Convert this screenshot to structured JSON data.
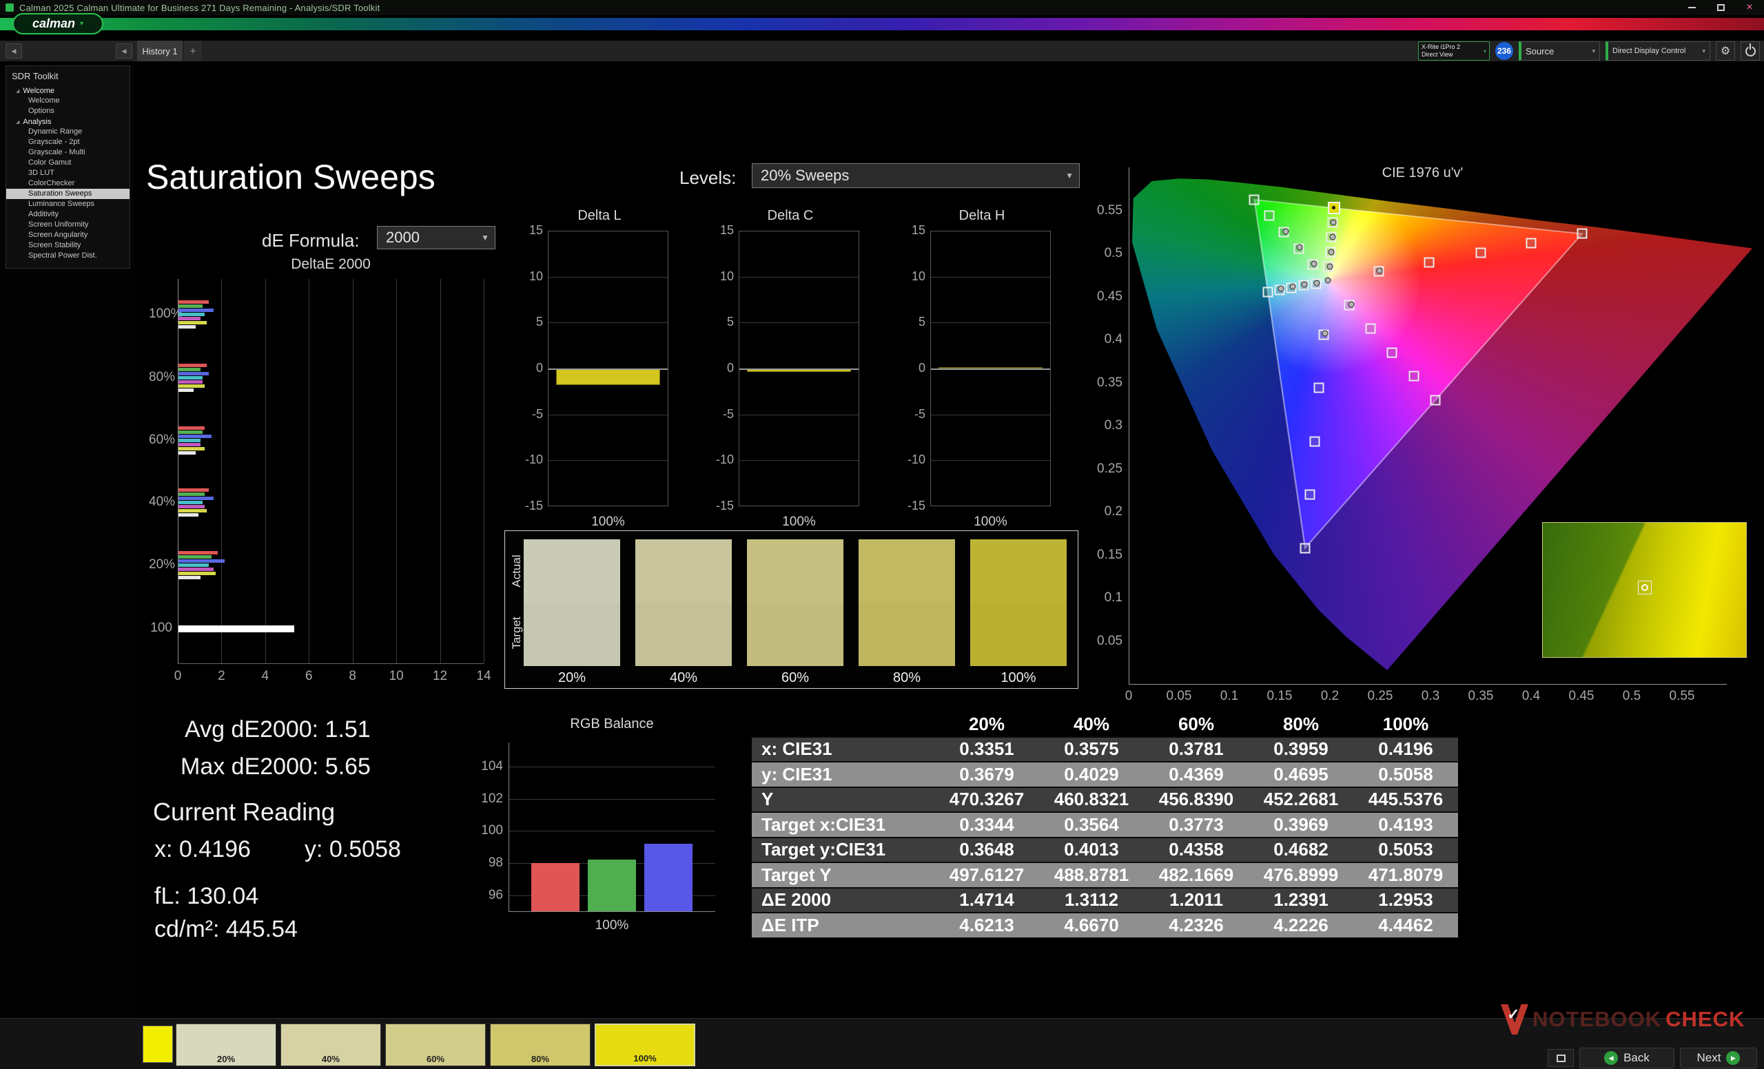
{
  "window": {
    "title": "Calman 2025 Calman Ultimate for Business 271 Days Remaining  - Analysis/SDR Toolkit"
  },
  "icons": {
    "close": "×",
    "dropdown": "▼",
    "small_caret": "▾",
    "tree_expanded": "◢",
    "back": "◀",
    "next": "▶",
    "collapse": "◀",
    "plus": "+",
    "gear": "⚙",
    "check": "✓"
  },
  "logo": {
    "text": "calman"
  },
  "toolbar": {
    "tab": "History 1",
    "meter_line1": "X-Rite i1Pro 2",
    "meter_line2": "Direct View",
    "badge": "236",
    "source": "Source",
    "display_control": "Direct Display Control"
  },
  "sidebar": {
    "header": "SDR Toolkit",
    "groups": [
      {
        "label": "Welcome",
        "items": [
          "Welcome",
          "Options"
        ]
      },
      {
        "label": "Analysis",
        "items": [
          "Dynamic Range",
          "Grayscale - 2pt",
          "Grayscale - Multi",
          "Color Gamut",
          "3D LUT",
          "ColorChecker",
          "Saturation Sweeps",
          "Luminance Sweeps",
          "Additivity",
          "Screen Uniformity",
          "Screen Angularity",
          "Screen Stability",
          "Spectral Power Dist."
        ]
      }
    ],
    "selected": "Saturation Sweeps"
  },
  "page": {
    "title": "Saturation Sweeps",
    "de_formula_label": "dE Formula:",
    "de_formula_value": "2000",
    "levels_label": "Levels:",
    "levels_value": "20% Sweeps"
  },
  "stats": {
    "avg": "Avg dE2000: 1.51",
    "max": "Max dE2000: 5.65",
    "current_heading": "Current Reading",
    "x": "x: 0.4196",
    "y": "y: 0.5058",
    "fl": "fL: 130.04",
    "cd": "cd/m²: 445.54"
  },
  "chart_data": [
    {
      "type": "bar",
      "title": "DeltaE 2000",
      "orientation": "horizontal",
      "xlim": [
        0,
        14
      ],
      "xticks": [
        0,
        2,
        4,
        6,
        8,
        10,
        12,
        14
      ],
      "bar_colors": [
        "#e05555",
        "#55b055",
        "#5868e0",
        "#48c0c8",
        "#c058c0",
        "#d8d848",
        "#e8e8e8"
      ],
      "clusters": [
        {
          "label": "100%",
          "values": [
            1.4,
            1.1,
            1.6,
            1.2,
            1.0,
            1.3,
            0.8
          ]
        },
        {
          "label": "80%",
          "values": [
            1.3,
            1.0,
            1.4,
            1.1,
            1.1,
            1.2,
            0.7
          ]
        },
        {
          "label": "60%",
          "values": [
            1.2,
            1.1,
            1.5,
            1.0,
            1.0,
            1.2,
            0.8
          ]
        },
        {
          "label": "40%",
          "values": [
            1.4,
            1.2,
            1.6,
            1.1,
            1.2,
            1.3,
            0.9
          ]
        },
        {
          "label": "20%",
          "values": [
            1.8,
            1.5,
            2.1,
            1.4,
            1.6,
            1.7,
            1.0
          ]
        },
        {
          "label": "100",
          "values": [
            5.3
          ],
          "colors": [
            "#ffffff"
          ]
        }
      ]
    },
    {
      "type": "bar",
      "title": "Delta L",
      "ylim": [
        -15,
        15
      ],
      "yticks": [
        15,
        10,
        5,
        0,
        -5,
        -10,
        -15
      ],
      "categories": [
        "100%"
      ],
      "values": [
        -1.8
      ],
      "color": "#d2c61f"
    },
    {
      "type": "bar",
      "title": "Delta C",
      "ylim": [
        -15,
        15
      ],
      "yticks": [
        15,
        10,
        5,
        0,
        -5,
        -10,
        -15
      ],
      "categories": [
        "100%"
      ],
      "values": [
        -0.4
      ],
      "color": "#d2c61f"
    },
    {
      "type": "bar",
      "title": "Delta H",
      "ylim": [
        -15,
        15
      ],
      "yticks": [
        15,
        10,
        5,
        0,
        -5,
        -10,
        -15
      ],
      "categories": [
        "100%"
      ],
      "values": [
        0.1
      ],
      "color": "#d2c61f"
    },
    {
      "type": "bar",
      "title": "RGB Balance",
      "ylim": [
        95,
        105.5
      ],
      "yticks": [
        104,
        102,
        100,
        98,
        96
      ],
      "categories": [
        "Red",
        "Green",
        "Blue"
      ],
      "values": [
        98.0,
        98.2,
        99.2
      ],
      "colors": [
        "#e05555",
        "#4fae4f",
        "#5858e8"
      ],
      "xlabel": "100%"
    },
    {
      "type": "scatter",
      "title": "CIE 1976 u'v'",
      "xlim": [
        0,
        0.62
      ],
      "ylim": [
        0,
        0.6
      ],
      "xticks": [
        "0",
        "0.05",
        "0.1",
        "0.15",
        "0.2",
        "0.25",
        "0.3",
        "0.35",
        "0.4",
        "0.45",
        "0.5",
        "0.55"
      ],
      "yticks": [
        "0.05",
        "0.1",
        "0.15",
        "0.2",
        "0.25",
        "0.3",
        "0.35",
        "0.4",
        "0.45",
        "0.5",
        "0.55"
      ],
      "white_point": [
        0.198,
        0.468
      ],
      "gamut_triangle": {
        "red": [
          0.4507,
          0.5229
        ],
        "green": [
          0.125,
          0.5625
        ],
        "blue": [
          0.1754,
          0.1579
        ]
      },
      "sweeps": [
        {
          "name": "red",
          "targets": [
            [
              0.249,
              0.479
            ],
            [
              0.299,
              0.49
            ],
            [
              0.35,
              0.501
            ],
            [
              0.4,
              0.512
            ],
            [
              0.4507,
              0.5229
            ]
          ]
        },
        {
          "name": "green",
          "targets": [
            [
              0.183,
              0.487
            ],
            [
              0.169,
              0.506
            ],
            [
              0.154,
              0.525
            ],
            [
              0.14,
              0.544
            ],
            [
              0.125,
              0.5625
            ]
          ]
        },
        {
          "name": "blue",
          "targets": [
            [
              0.194,
              0.406
            ],
            [
              0.189,
              0.344
            ],
            [
              0.185,
              0.282
            ],
            [
              0.18,
              0.22
            ],
            [
              0.1754,
              0.1579
            ]
          ]
        },
        {
          "name": "yellow",
          "targets": [
            [
              0.199,
              0.485
            ],
            [
              0.2005,
              0.502
            ],
            [
              0.2015,
              0.519
            ],
            [
              0.2027,
              0.536
            ],
            [
              0.2039,
              0.5529
            ]
          ]
        },
        {
          "name": "cyan",
          "targets": [
            [
              0.186,
              0.465
            ],
            [
              0.174,
              0.463
            ],
            [
              0.162,
              0.46
            ],
            [
              0.15,
              0.458
            ],
            [
              0.1383,
              0.4554
            ]
          ]
        },
        {
          "name": "magenta",
          "targets": [
            [
              0.219,
              0.44
            ],
            [
              0.2405,
              0.413
            ],
            [
              0.262,
              0.385
            ],
            [
              0.2835,
              0.358
            ],
            [
              0.305,
              0.3298
            ]
          ]
        }
      ],
      "measured": [
        [
          0.2,
          0.485
        ],
        [
          0.2015,
          0.502
        ],
        [
          0.2025,
          0.519
        ],
        [
          0.2035,
          0.536
        ],
        [
          0.184,
          0.488
        ],
        [
          0.17,
          0.507
        ],
        [
          0.156,
          0.526
        ],
        [
          0.187,
          0.466
        ],
        [
          0.175,
          0.464
        ],
        [
          0.163,
          0.4615
        ],
        [
          0.1515,
          0.459
        ],
        [
          0.2495,
          0.48
        ],
        [
          0.2215,
          0.441
        ],
        [
          0.1955,
          0.407
        ],
        [
          0.198,
          0.469
        ]
      ],
      "current_point": [
        0.2039,
        0.5529
      ],
      "inset": {
        "point": [
          0.5,
          0.48
        ]
      }
    }
  ],
  "table": {
    "columns": [
      "",
      "20%",
      "40%",
      "60%",
      "80%",
      "100%"
    ],
    "rows": [
      {
        "label": "x: CIE31",
        "values": [
          "0.3351",
          "0.3575",
          "0.3781",
          "0.3959",
          "0.4196"
        ]
      },
      {
        "label": "y: CIE31",
        "values": [
          "0.3679",
          "0.4029",
          "0.4369",
          "0.4695",
          "0.5058"
        ]
      },
      {
        "label": "Y",
        "values": [
          "470.3267",
          "460.8321",
          "456.8390",
          "452.2681",
          "445.5376"
        ]
      },
      {
        "label": "Target x:CIE31",
        "values": [
          "0.3344",
          "0.3564",
          "0.3773",
          "0.3969",
          "0.4193"
        ]
      },
      {
        "label": "Target y:CIE31",
        "values": [
          "0.3648",
          "0.4013",
          "0.4358",
          "0.4682",
          "0.5053"
        ]
      },
      {
        "label": "Target Y",
        "values": [
          "497.6127",
          "488.8781",
          "482.1669",
          "476.8999",
          "471.8079"
        ]
      },
      {
        "label": "ΔE 2000",
        "values": [
          "1.4714",
          "1.3112",
          "1.2011",
          "1.2391",
          "1.2953"
        ]
      },
      {
        "label": "ΔE ITP",
        "values": [
          "4.6213",
          "4.6670",
          "4.2326",
          "4.2226",
          "4.4462"
        ]
      }
    ]
  },
  "swatches": {
    "actual_label": "Actual",
    "target_label": "Target",
    "items": [
      {
        "label": "20%",
        "actual": "#c9cbb6",
        "target": "#c5c7b2"
      },
      {
        "label": "40%",
        "actual": "#c8c59c",
        "target": "#c4c198"
      },
      {
        "label": "60%",
        "actual": "#c5c081",
        "target": "#c1bc7d"
      },
      {
        "label": "80%",
        "actual": "#c1ba63",
        "target": "#bdb65f"
      },
      {
        "label": "100%",
        "actual": "#beb434",
        "target": "#bab030"
      }
    ]
  },
  "footer": {
    "mini_thumb_color": "#f2ee00",
    "thumbs": [
      {
        "label": "20%",
        "color": "#d8d8bc"
      },
      {
        "label": "40%",
        "color": "#d6d2a4"
      },
      {
        "label": "60%",
        "color": "#d3cd8c"
      },
      {
        "label": "80%",
        "color": "#d0c76c"
      },
      {
        "label": "100%",
        "color": "#e6dc10",
        "selected": true
      }
    ],
    "back_label": "Back",
    "next_label": "Next",
    "watermark": {
      "part1": "NOTEBOOK",
      "part2": "CHECK"
    }
  }
}
